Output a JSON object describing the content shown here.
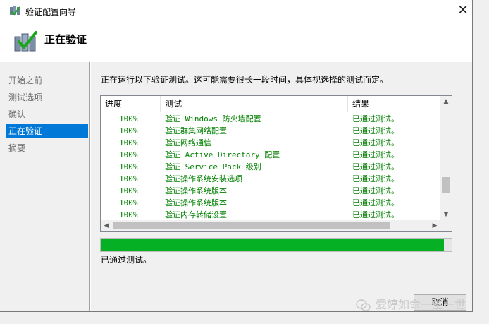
{
  "window": {
    "title": "验证配置向导",
    "close_glyph": "✕"
  },
  "header": {
    "title": "正在验证"
  },
  "sidebar": {
    "items": [
      {
        "label": "开始之前",
        "active": false
      },
      {
        "label": "测试选项",
        "active": false
      },
      {
        "label": "确认",
        "active": false
      },
      {
        "label": "正在验证",
        "active": true
      },
      {
        "label": "摘要",
        "active": false
      }
    ]
  },
  "main": {
    "description": "正在运行以下验证测试。这可能需要很长一段时间，具体视选择的测试而定。",
    "columns": {
      "progress": "进度",
      "test": "测试",
      "result": "结果"
    },
    "rows": [
      {
        "progress": "100%",
        "test": "验证 Windows 防火墙配置",
        "result": "已通过测试。"
      },
      {
        "progress": "100%",
        "test": "验证群集网络配置",
        "result": "已通过测试。"
      },
      {
        "progress": "100%",
        "test": "验证网络通信",
        "result": "已通过测试。"
      },
      {
        "progress": "100%",
        "test": "验证 Active Directory 配置",
        "result": "已通过测试。"
      },
      {
        "progress": "100%",
        "test": "验证 Service Pack 级别",
        "result": "已通过测试。"
      },
      {
        "progress": "100%",
        "test": "验证操作系统安装选项",
        "result": "已通过测试。"
      },
      {
        "progress": "100%",
        "test": "验证操作系统版本",
        "result": "已通过测试。"
      },
      {
        "progress": "100%",
        "test": "验证操作系统版本",
        "result": "已通过测试。"
      },
      {
        "progress": "100%",
        "test": "验证内存转储设置",
        "result": "已通过测试。"
      }
    ],
    "overall_progress": 0.98,
    "status_text": "已通过测试。",
    "cancel_label": "取消"
  },
  "watermark": {
    "text": "爱婷如命一生一世"
  },
  "colors": {
    "accent": "#0078d7",
    "progress_fill": "#06b025",
    "row_text": "#008000"
  },
  "icons": {
    "title": "cluster-wizard-icon",
    "header": "cluster-validate-icon"
  }
}
